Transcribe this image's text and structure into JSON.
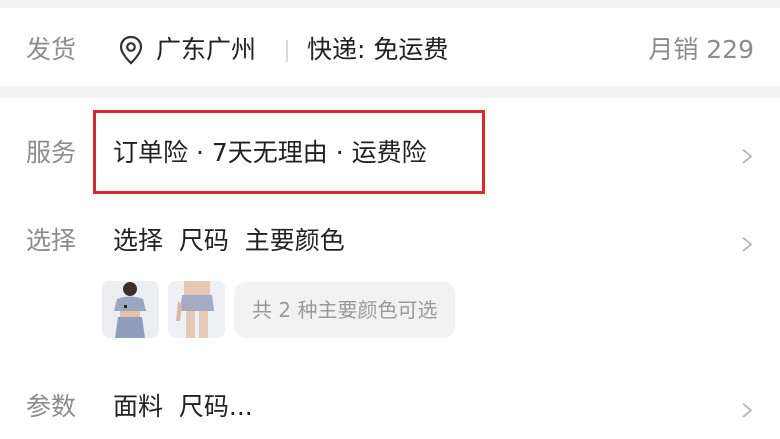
{
  "shipping": {
    "label": "发货",
    "location": "广东广州",
    "express": "快递: 免运费",
    "monthly_sales": "月销 229",
    "location_icon": "location-pin-icon"
  },
  "service": {
    "label": "服务",
    "value": "订单险 · 7天无理由 · 运费险",
    "highlight_color": "#d42a2a"
  },
  "select": {
    "label": "选择",
    "value": "选择  尺码  主要颜色",
    "colors_available": "共 2 种主要颜色可选",
    "thumbnails": [
      "product-thumbnail",
      "product-thumbnail"
    ]
  },
  "params": {
    "label": "参数",
    "value": "面料  尺码..."
  },
  "icons": {
    "chevron": "chevron-right-icon"
  }
}
